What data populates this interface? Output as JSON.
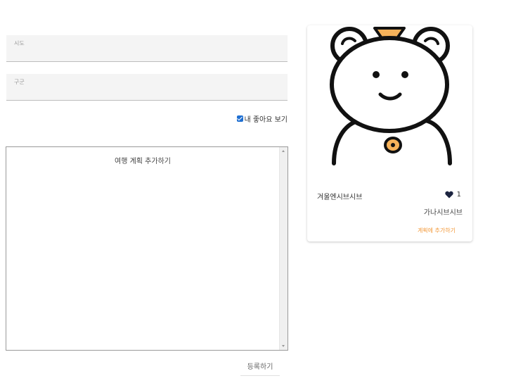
{
  "form": {
    "sido_label": "시도",
    "gugun_label": "구군",
    "my_likes_label": "내 좋아요 보기",
    "my_likes_checked": true
  },
  "plan": {
    "title": "여행 계획 추가하기"
  },
  "register_label": "등록하기",
  "card": {
    "name": "겨울엔시브시브",
    "like_count": "1",
    "author": "가나시브시브",
    "add_to_plan": "계획에 추가하기",
    "accent_color": "#f39a3b",
    "heart_color": "#1c2440"
  }
}
